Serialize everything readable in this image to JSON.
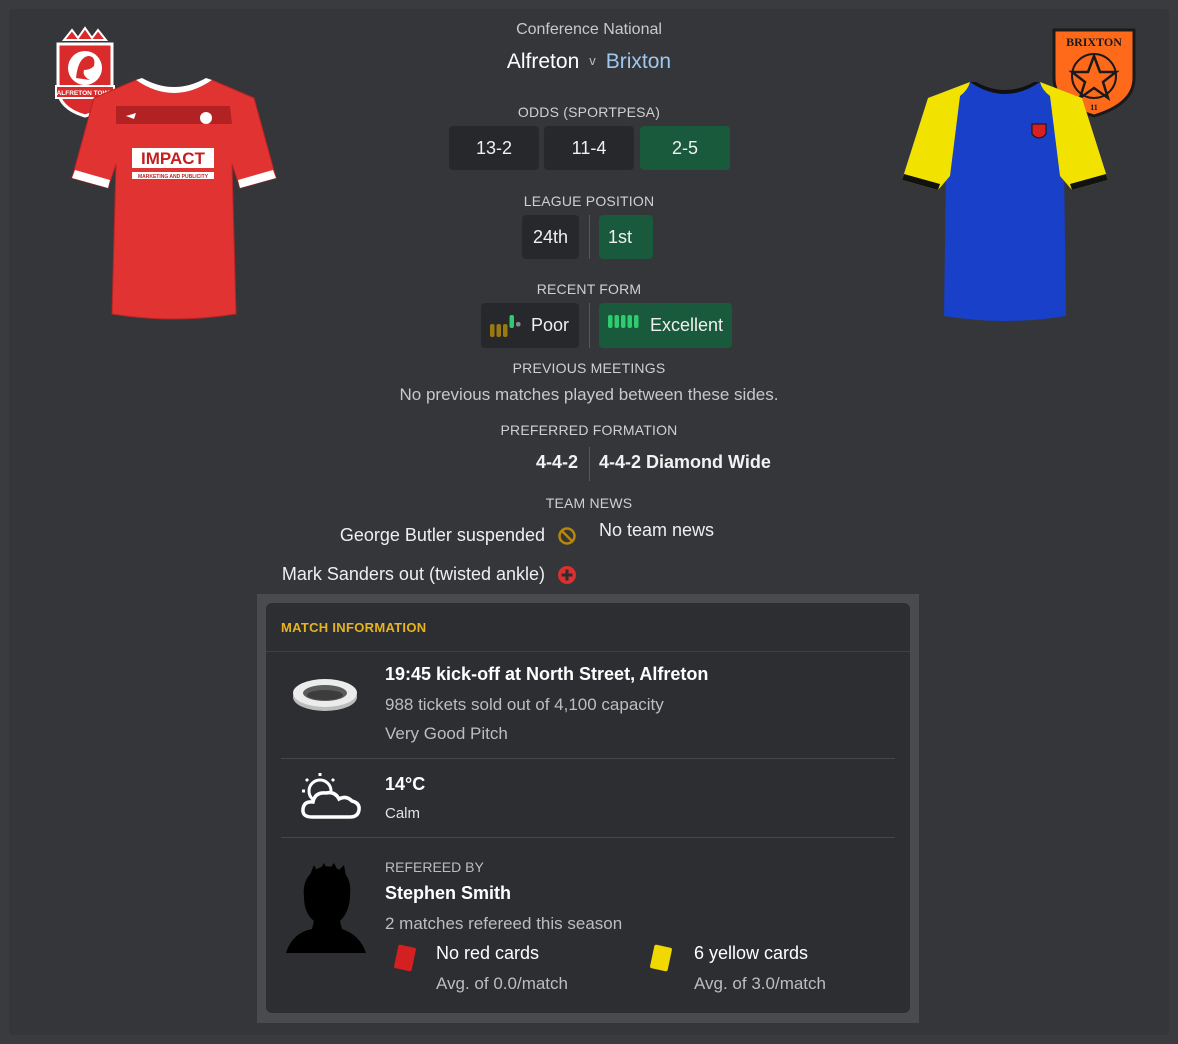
{
  "header": {
    "competition": "Conference National",
    "home_team": "Alfreton",
    "vs": "v",
    "away_team": "Brixton"
  },
  "home_crest": {
    "text_top": "ALFRETON TOWN",
    "color": "#d92b2b"
  },
  "away_crest": {
    "text_top": "BRIXTON",
    "text_bottom": "11",
    "color": "#ff6a1a"
  },
  "home_kit": {
    "sponsor": "IMPACT",
    "sponsor_sub": "MARKETING AND PUBLICITY",
    "color": "#e23333"
  },
  "away_kit": {
    "body_color": "#1840c8",
    "sleeve_color": "#f2e200"
  },
  "odds": {
    "label": "ODDS (SPORTPESA)",
    "home": "13-2",
    "draw": "11-4",
    "away": "2-5"
  },
  "league_position": {
    "label": "LEAGUE POSITION",
    "home": "24th",
    "away": "1st"
  },
  "recent_form": {
    "label": "RECENT FORM",
    "home": "Poor",
    "away": "Excellent"
  },
  "previous_meetings": {
    "label": "PREVIOUS MEETINGS",
    "text": "No previous matches played between these sides."
  },
  "preferred_formation": {
    "label": "PREFERRED FORMATION",
    "home": "4-4-2",
    "away": "4-4-2 Diamond Wide"
  },
  "team_news": {
    "label": "TEAM NEWS",
    "home": [
      {
        "text": "George Butler suspended",
        "icon": "suspended-icon"
      },
      {
        "text": "Mark Sanders out (twisted ankle)",
        "icon": "injury-icon"
      }
    ],
    "away": "No team news"
  },
  "match_info": {
    "title": "MATCH INFORMATION",
    "venue": {
      "kickoff": "19:45 kick-off at North Street, Alfreton",
      "tickets": "988 tickets sold out of 4,100 capacity",
      "pitch": "Very Good Pitch"
    },
    "weather": {
      "temperature": "14°C",
      "condition": "Calm"
    },
    "referee": {
      "label": "REFEREED BY",
      "name": "Stephen Smith",
      "matches": "2 matches refereed this season",
      "red_cards": "No red cards",
      "red_avg": "Avg. of 0.0/match",
      "yellow_cards": "6 yellow cards",
      "yellow_avg": "Avg. of 3.0/match"
    }
  },
  "colors": {
    "accent_gold": "#e6b422",
    "green_box": "#1a5a3c",
    "away_link": "#9ec8ee"
  }
}
